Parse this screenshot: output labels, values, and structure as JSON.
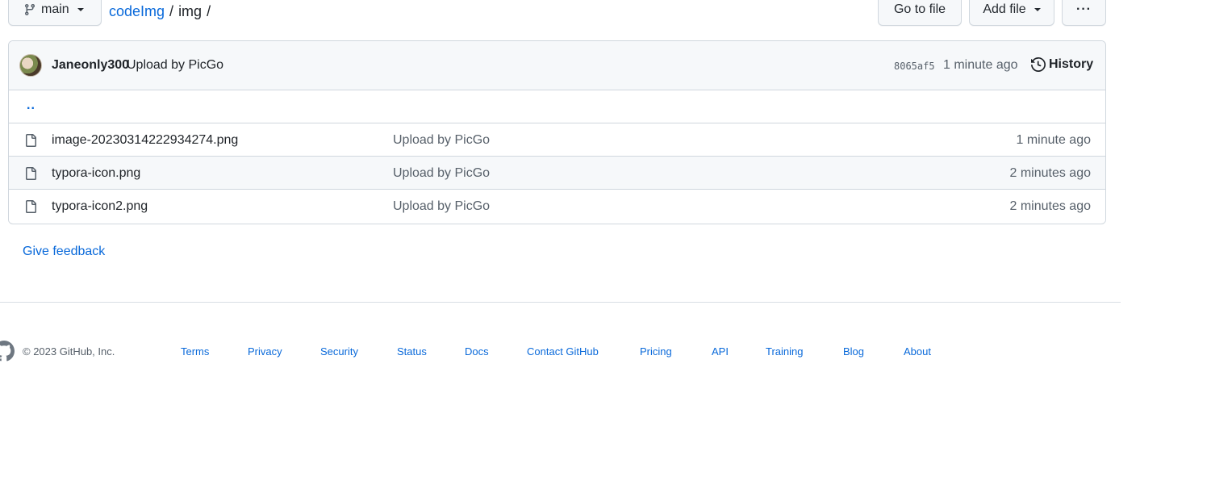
{
  "toolbar": {
    "branch": "main",
    "breadcrumb_repo": "codeImg",
    "breadcrumb_sep": "/",
    "breadcrumb_folder": "img",
    "breadcrumb_trailing_sep": "/",
    "goto_file": "Go to file",
    "add_file": "Add file",
    "more": "···"
  },
  "commit": {
    "author": "Janeonly300",
    "message": "Upload by PicGo",
    "sha": "8065af5",
    "time": "1 minute ago",
    "history_label": "History"
  },
  "parent_dir": "..",
  "files": [
    {
      "name": "image-20230314222934274.png",
      "message": "Upload by PicGo",
      "time": "1 minute ago"
    },
    {
      "name": "typora-icon.png",
      "message": "Upload by PicGo",
      "time": "2 minutes ago"
    },
    {
      "name": "typora-icon2.png",
      "message": "Upload by PicGo",
      "time": "2 minutes ago"
    }
  ],
  "feedback": "Give feedback",
  "footer": {
    "copyright": "© 2023 GitHub, Inc.",
    "links": [
      "Terms",
      "Privacy",
      "Security",
      "Status",
      "Docs",
      "Contact GitHub",
      "Pricing",
      "API",
      "Training",
      "Blog",
      "About"
    ]
  },
  "colors": {
    "link": "#0969da",
    "text": "#1f2328",
    "muted": "#57606a",
    "border": "#d0d7de",
    "header_bg": "#f6f8fa"
  },
  "icons": [
    "branch-icon",
    "history-icon",
    "file-icon",
    "github-logo-icon"
  ]
}
